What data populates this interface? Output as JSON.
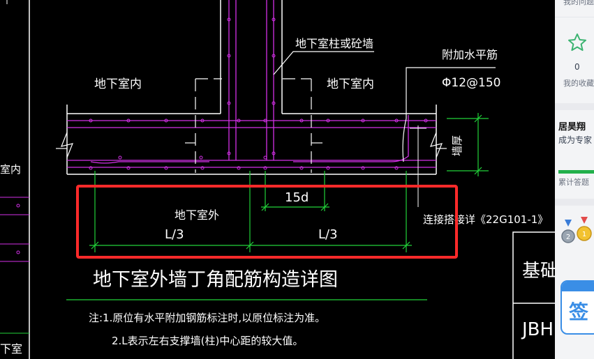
{
  "drawing": {
    "column_label": "地下室柱或砼墙",
    "interior_left": "地下室内",
    "interior_right": "地下室内",
    "extra_bar_label": "附加水平筋",
    "extra_bar_spec": "Φ12@150",
    "wall_thickness_label": "墙厚",
    "exterior_label": "地下室外",
    "dim_15d": "15d",
    "dim_left": "L/3",
    "dim_right": "L/3",
    "ref_note": "连接搭接详《22G101-1》",
    "title": "地下室外墙丁角配筋构造详图",
    "note1": "注:1.原位有水平附加钢筋标注时,以原位标注为准。",
    "note2": "2.L表示左右支撑墙(柱)中心距的较大值。",
    "left_cut_1": "室内",
    "left_cut_2": "下室",
    "table_cell_1": "基础",
    "table_cell_2": "JBH"
  },
  "sidebar": {
    "top_text": "我的问题",
    "collect_count": "0",
    "collect_label": "我的收藏",
    "user_name": "居昊翔",
    "user_sub": "成为专家",
    "answers_label": "累计答题",
    "sign_label": "签"
  },
  "colors": {
    "highlight": "#ff2a2a",
    "rebar": "#d430e8",
    "dimension": "#22d33a",
    "outline": "#ffffff"
  }
}
